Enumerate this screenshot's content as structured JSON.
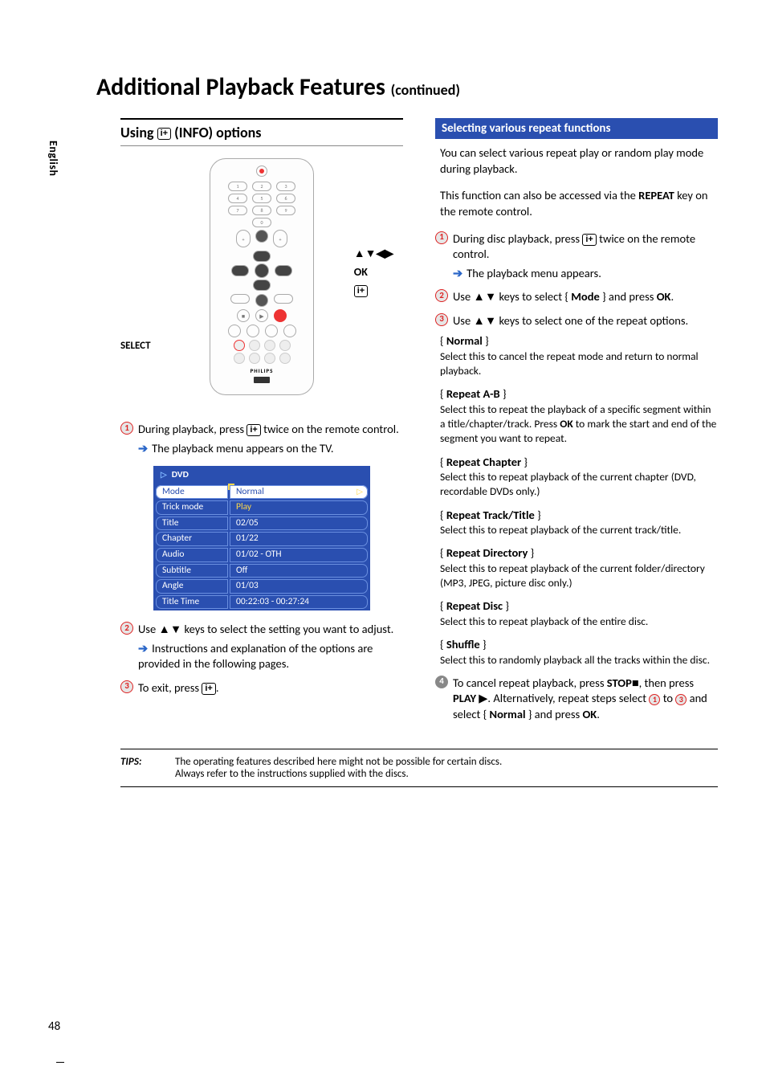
{
  "page": {
    "language_tab": "English",
    "title_main": "Additional Playback Features",
    "title_cont": "(continued)",
    "page_number": "48"
  },
  "left": {
    "section_title_pre": "Using ",
    "section_title_post": " (INFO) options",
    "info_glyph": "i+",
    "callouts": {
      "arrows": "▲▼◀▶",
      "ok": "OK",
      "select": "SELECT"
    },
    "remote_brand": "PHILIPS",
    "step1_a": "During playback, press ",
    "step1_b": " twice on the remote control.",
    "step1_sub": "The playback menu appears on the TV.",
    "osd": {
      "header": "DVD",
      "rows": [
        {
          "label": "Mode",
          "value": "Normal"
        },
        {
          "label": "Trick mode",
          "value": "Play"
        },
        {
          "label": "Title",
          "value": "02/05"
        },
        {
          "label": "Chapter",
          "value": "01/22"
        },
        {
          "label": "Audio",
          "value": "01/02 - OTH"
        },
        {
          "label": "Subtitle",
          "value": "Off"
        },
        {
          "label": "Angle",
          "value": "01/03"
        },
        {
          "label": "Title Time",
          "value": "00:22:03 - 00:27:24"
        }
      ]
    },
    "step2": "Use ▲▼ keys to select the setting you want to adjust.",
    "step2_sub": "Instructions and explanation of the options are provided in the following pages.",
    "step3_a": "To exit, press ",
    "step3_b": "."
  },
  "right": {
    "sub_heading": "Selecting various repeat functions",
    "intro1": "You can select various repeat play or random play mode during playback.",
    "intro2_a": "This function can also be accessed via the ",
    "intro2_bold": "REPEAT",
    "intro2_b": " key on the remote control.",
    "step1_a": "During disc playback, press ",
    "step1_b": " twice on the remote control.",
    "step1_sub": "The playback menu appears.",
    "step2_a": "Use ▲▼ keys to select { ",
    "step2_bold": "Mode",
    "step2_b": " } and press ",
    "step2_bold2": "OK",
    "step2_c": ".",
    "step3": "Use ▲▼ keys to select one of the repeat options.",
    "options": [
      {
        "title": "Normal",
        "desc": "Select this to cancel the repeat mode and return to normal playback."
      },
      {
        "title": "Repeat A-B",
        "desc": "Select this to repeat the playback of a specific segment within a title/chapter/track. Press OK to mark the start and end of the segment you want to repeat."
      },
      {
        "title": "Repeat Chapter",
        "desc": "Select this to repeat playback of the current chapter (DVD, recordable DVDs only.)"
      },
      {
        "title": "Repeat Track/Title",
        "desc": "Select this to repeat playback of the current track/title."
      },
      {
        "title": "Repeat Directory",
        "desc": "Select this to repeat playback of the current folder/directory (MP3, JPEG, picture disc only.)"
      },
      {
        "title": "Repeat Disc",
        "desc": "Select this to repeat playback of the entire disc."
      },
      {
        "title": "Shuffle",
        "desc": "Select this to randomly playback all the tracks within the disc."
      }
    ],
    "step4_a": "To cancel repeat playback, press ",
    "step4_stop": "STOP",
    "step4_b": "■, then press ",
    "step4_play": "PLAY",
    "step4_c": " ▶. Alternatively, repeat steps select ",
    "step4_d": " to ",
    "step4_e": " and select { ",
    "step4_normal": "Normal",
    "step4_f": " } and press ",
    "step4_ok": "OK",
    "step4_g": "."
  },
  "tips": {
    "label": "TIPS:",
    "line1": "The operating features described here might not be possible for certain discs.",
    "line2": "Always refer to the instructions supplied with the discs."
  }
}
